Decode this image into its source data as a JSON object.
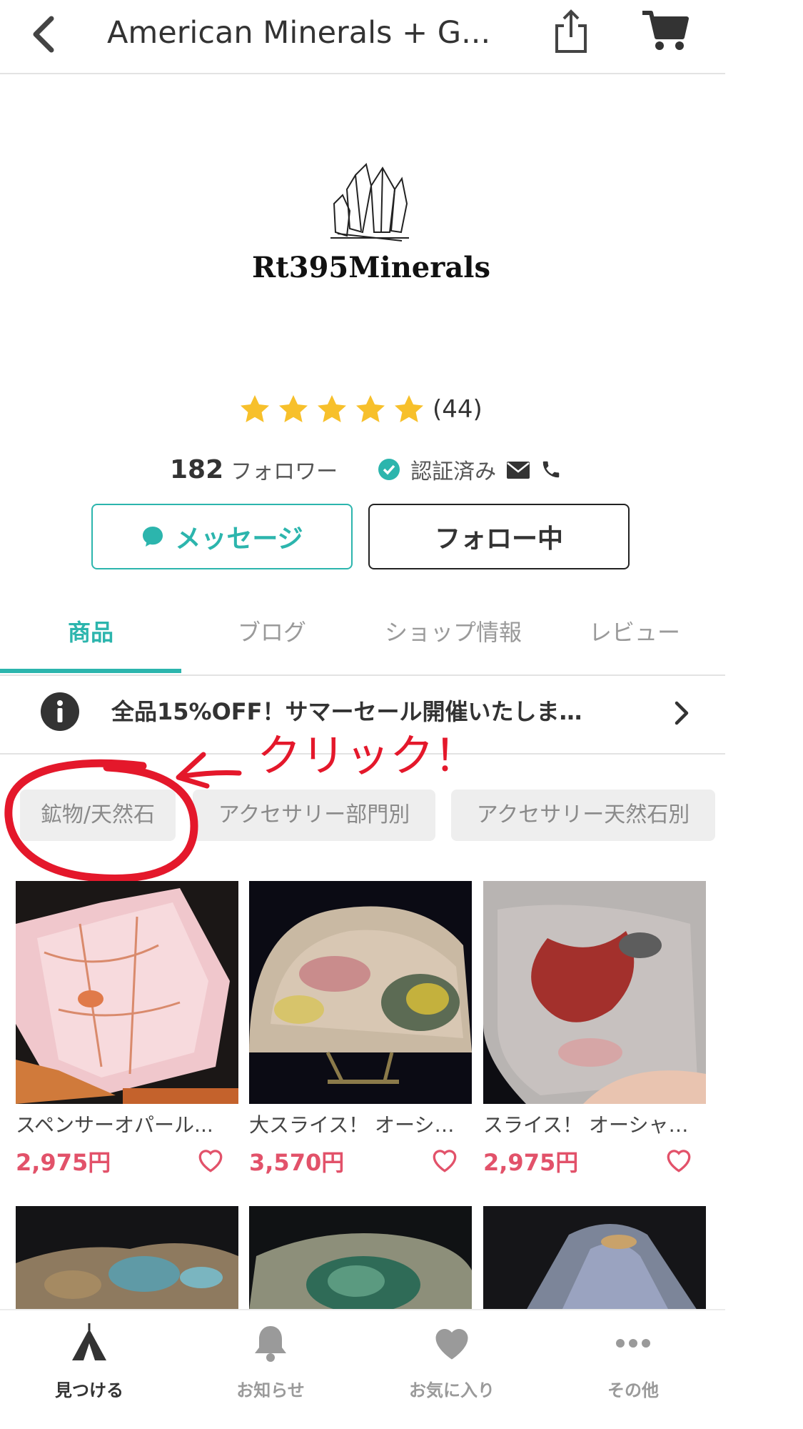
{
  "header": {
    "title": "American Minerals + G...",
    "back_icon": "chevron-left-icon",
    "share_icon": "share-icon",
    "cart_icon": "cart-icon"
  },
  "shop": {
    "logo_text": "Rt395Minerals",
    "rating_stars": 5,
    "rating_count": "(44)",
    "follower_count": "182",
    "follower_label": "フォロワー",
    "verified_label": "認証済み"
  },
  "buttons": {
    "message": "メッセージ",
    "follow": "フォロー中"
  },
  "tabs": [
    {
      "label": "商品",
      "active": true
    },
    {
      "label": "ブログ",
      "active": false
    },
    {
      "label": "ショップ情報",
      "active": false
    },
    {
      "label": "レビュー",
      "active": false
    }
  ],
  "notice": {
    "text": "全品15%OFF！サマーセール開催いたしま…"
  },
  "annotation": {
    "text": "クリック！"
  },
  "categories": [
    {
      "label": "鉱物/天然石"
    },
    {
      "label": "アクセサリー部門別"
    },
    {
      "label": "アクセサリー天然石別"
    }
  ],
  "products": [
    {
      "name": "スペンサーオパール...",
      "price": "2,975円"
    },
    {
      "name": "大スライス！ オーシ…",
      "price": "3,570円"
    },
    {
      "name": "スライス！ オーシャ…",
      "price": "2,975円"
    }
  ],
  "bottom_nav": [
    {
      "label": "見つける",
      "icon": "tent-icon",
      "active": true
    },
    {
      "label": "お知らせ",
      "icon": "bell-icon",
      "active": false
    },
    {
      "label": "お気に入り",
      "icon": "heart-icon",
      "active": false
    },
    {
      "label": "その他",
      "icon": "more-icon",
      "active": false
    }
  ],
  "colors": {
    "accent": "#2cb5ad",
    "price": "#e2526a",
    "star": "#f7c02b",
    "annotation": "#e4182b"
  }
}
